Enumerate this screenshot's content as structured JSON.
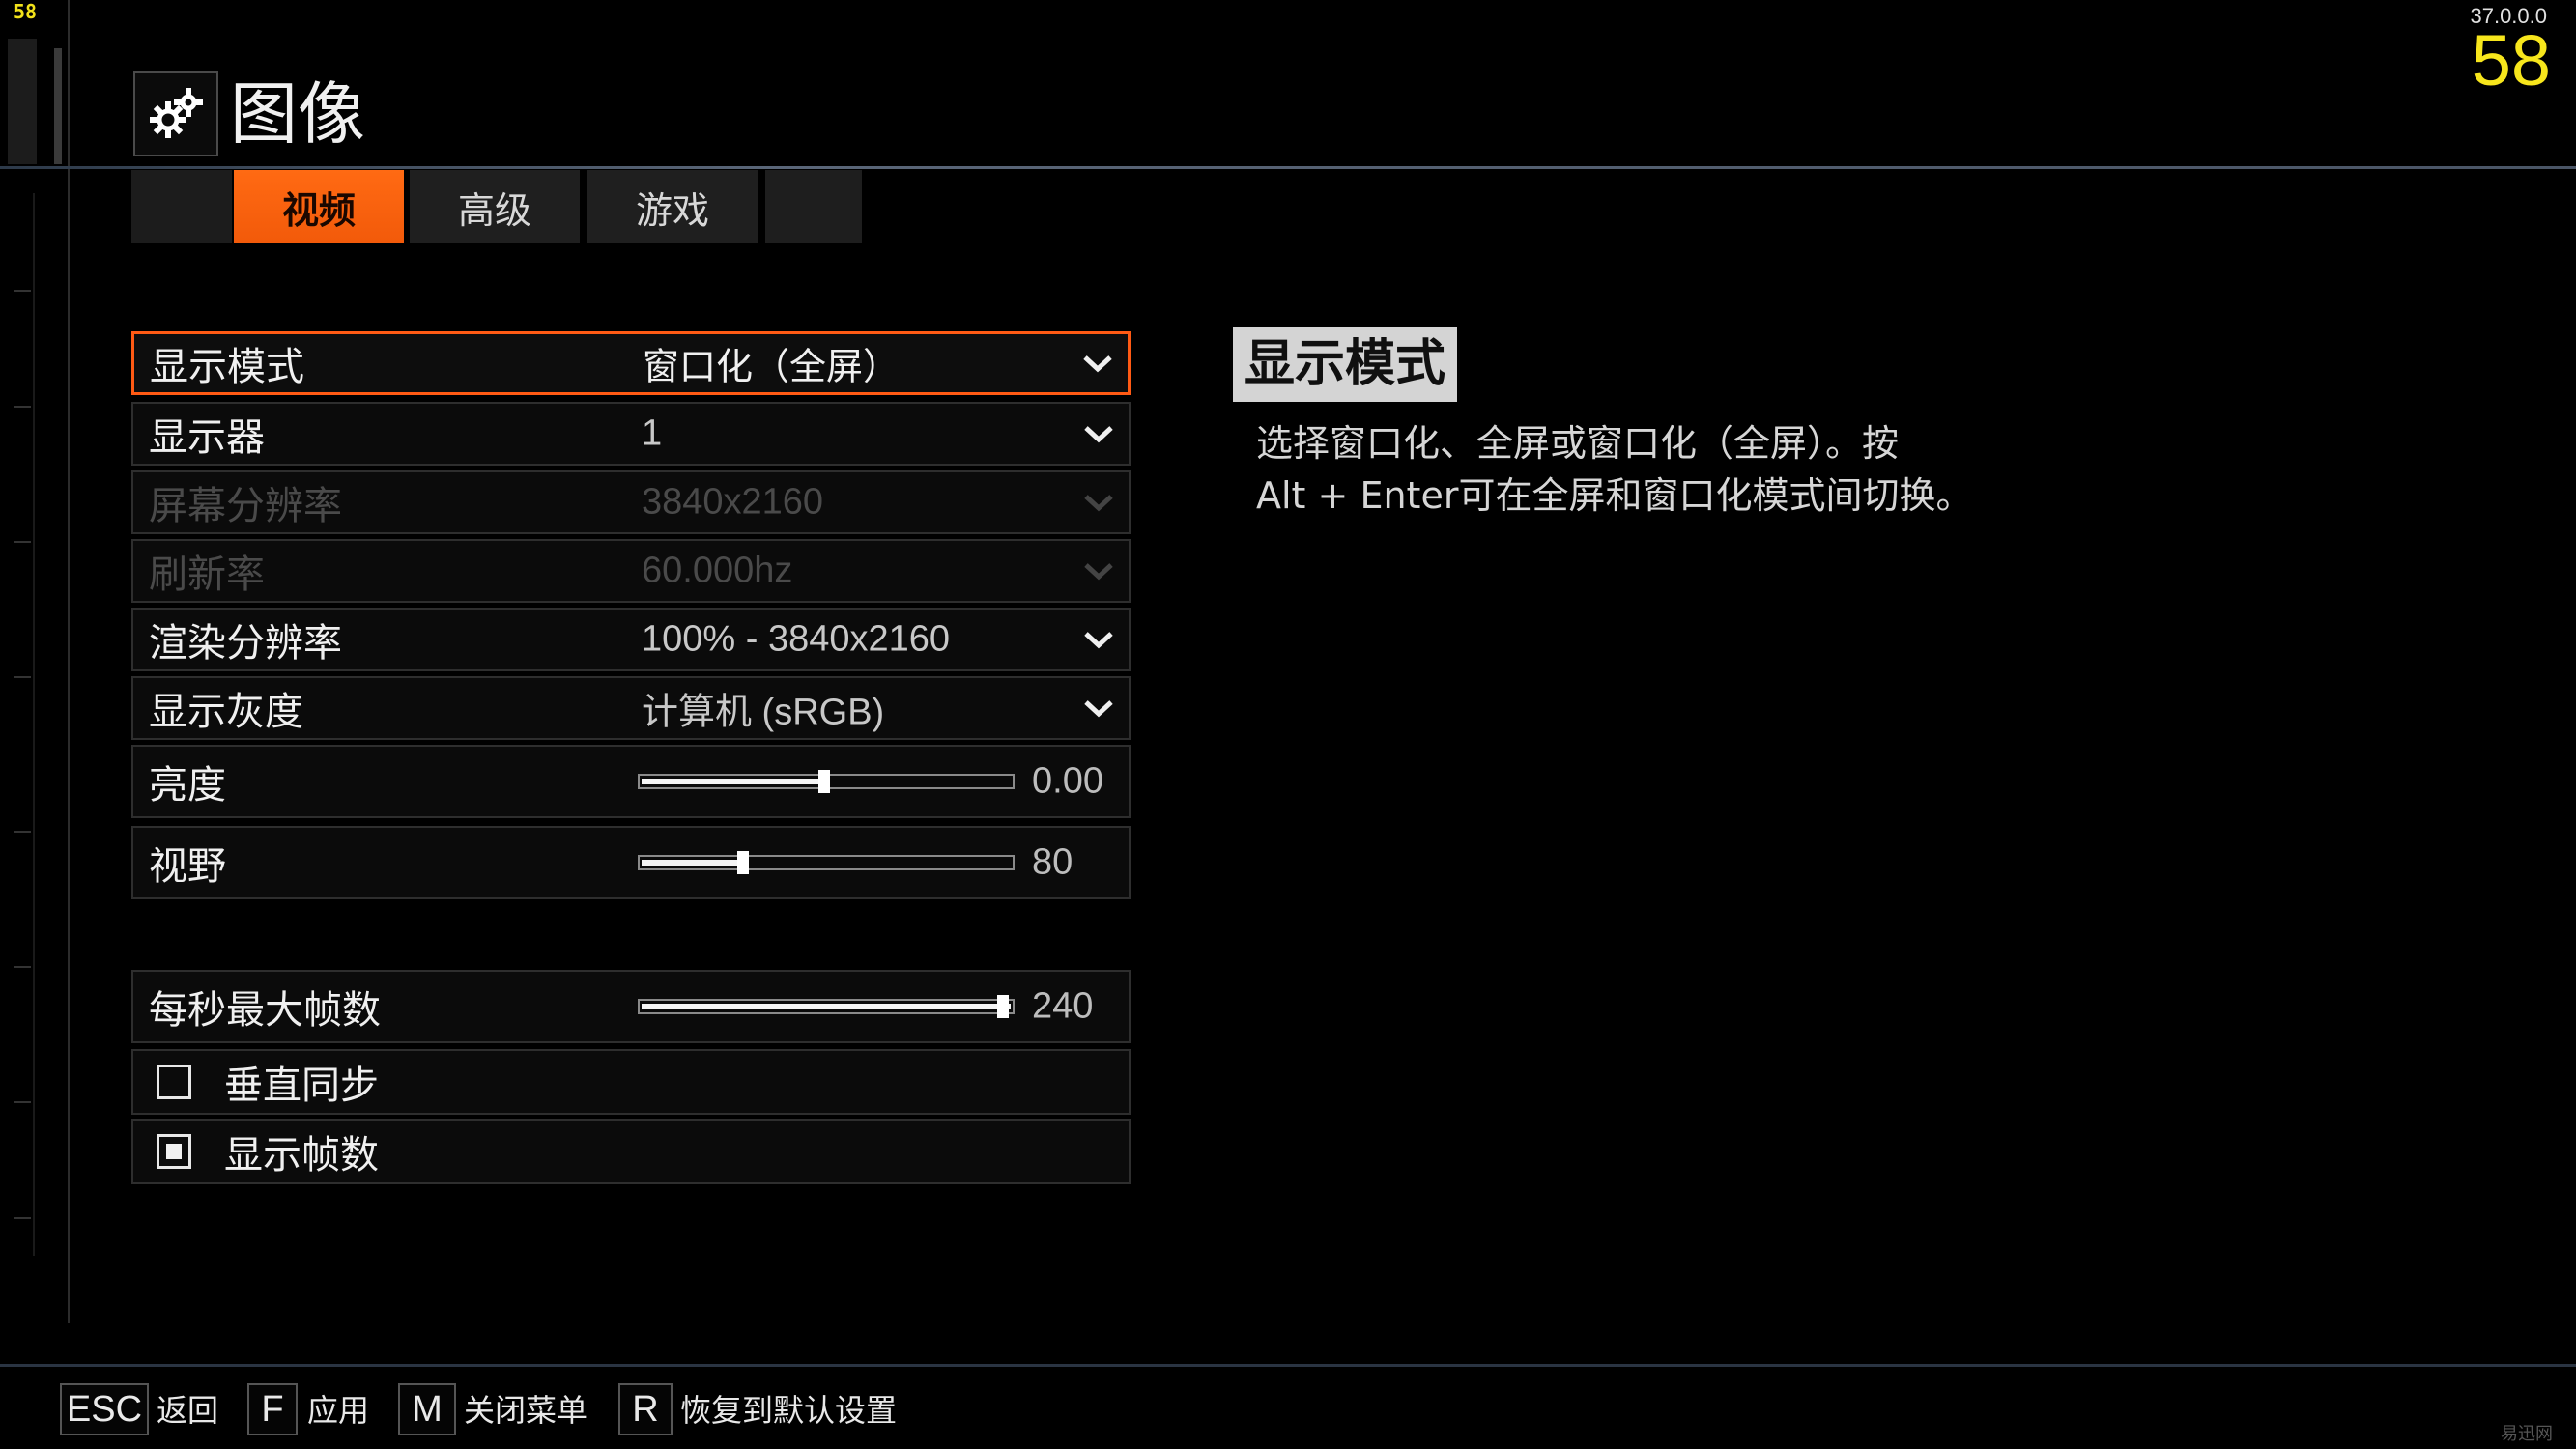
{
  "hud": {
    "fps_small": "58",
    "version": "37.0.0.0",
    "fps_big": "58"
  },
  "header": {
    "title": "图像",
    "icon": "gears-icon"
  },
  "tabs": [
    {
      "label": "视频",
      "active": true
    },
    {
      "label": "高级",
      "active": false
    },
    {
      "label": "游戏",
      "active": false
    }
  ],
  "settings": {
    "display_mode": {
      "label": "显示模式",
      "value": "窗口化（全屏）"
    },
    "monitor": {
      "label": "显示器",
      "value": "1"
    },
    "resolution": {
      "label": "屏幕分辨率",
      "value": "3840x2160"
    },
    "refresh_rate": {
      "label": "刷新率",
      "value": "60.000hz"
    },
    "render_resolution": {
      "label": "渲染分辨率",
      "value": "100% - 3840x2160"
    },
    "display_gamma": {
      "label": "显示灰度",
      "value": "计算机 (sRGB)"
    },
    "brightness": {
      "label": "亮度",
      "value": "0.00",
      "level": 0.5
    },
    "fov": {
      "label": "视野",
      "value": "80",
      "level": 0.28
    },
    "max_fps": {
      "label": "每秒最大帧数",
      "value": "240",
      "level": 1.0
    },
    "vsync": {
      "label": "垂直同步",
      "checked": false
    },
    "show_fps": {
      "label": "显示帧数",
      "checked": true
    }
  },
  "description": {
    "title": "显示模式",
    "line1": "选择窗口化、全屏或窗口化（全屏）。按",
    "line2": "Alt + Enter可在全屏和窗口化模式间切换。"
  },
  "footer": [
    {
      "key": "ESC",
      "label": "返回"
    },
    {
      "key": "F",
      "label": "应用"
    },
    {
      "key": "M",
      "label": "关闭菜单"
    },
    {
      "key": "R",
      "label": "恢复到默认设置"
    }
  ],
  "watermark": "易迅网"
}
